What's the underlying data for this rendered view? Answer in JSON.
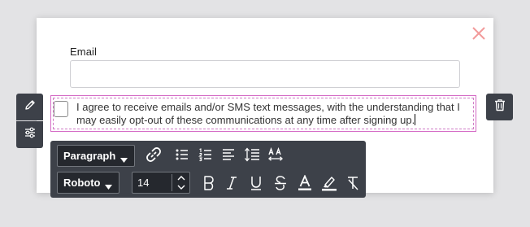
{
  "form": {
    "email_label": "Email",
    "email_value": "",
    "consent_text": "I agree to receive emails and/or SMS text messages, with the understanding that I may easily opt-out of these communications at any time after signing up."
  },
  "toolbar": {
    "paragraph_style": "Paragraph",
    "font_family": "Roboto",
    "font_size": "14"
  },
  "icons": {
    "close": "close-icon",
    "edit": "pencil-icon",
    "settings": "sliders-icon",
    "trash": "trash-icon",
    "unlink": "unlink-icon",
    "bullet_list": "bullet-list-icon",
    "numbered_list": "numbered-list-icon",
    "align": "align-left-icon",
    "line_height": "line-height-icon",
    "letter_spacing": "letter-spacing-icon",
    "bold": "bold-icon",
    "italic": "italic-icon",
    "underline": "underline-icon",
    "strikethrough": "strikethrough-icon",
    "text_color": "text-color-icon",
    "highlight": "highlighter-icon",
    "clear_format": "clear-format-icon"
  },
  "colors": {
    "close": "#f29b9b",
    "selection_outline": "#d46ac5",
    "toolbar_bg": "#3d4149",
    "page_bg": "#e3e3e5"
  }
}
